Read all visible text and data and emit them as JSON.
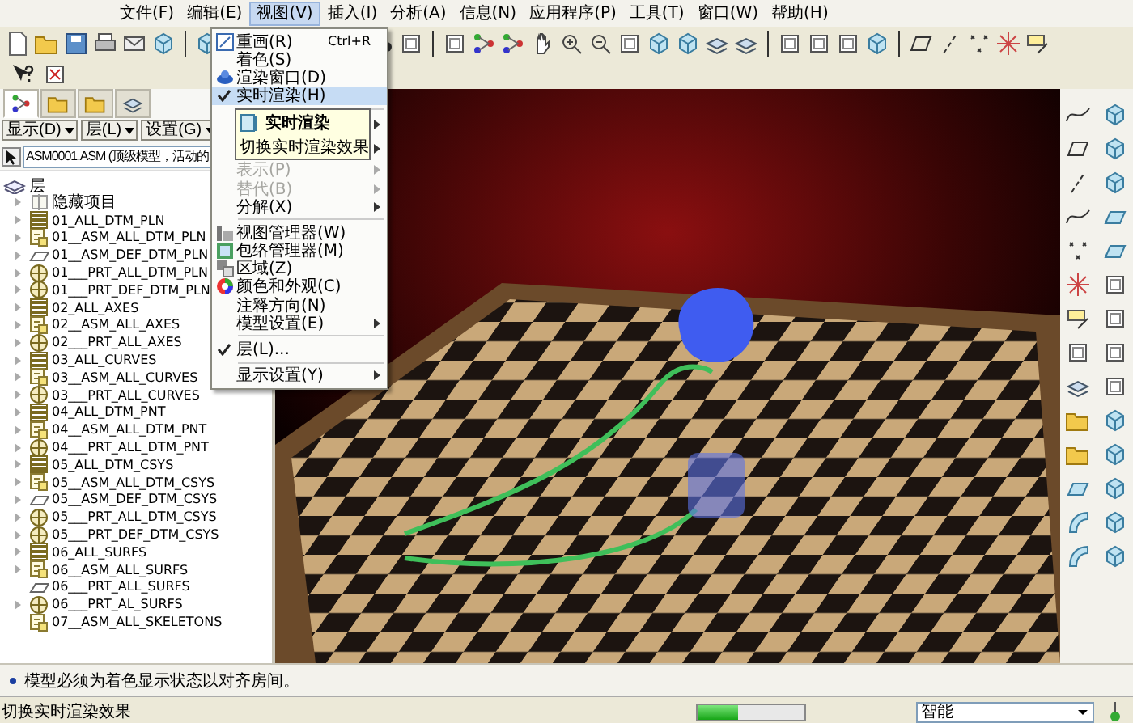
{
  "menu_bar": [
    {
      "label": "文件(F)",
      "selected": false
    },
    {
      "label": "编辑(E)",
      "selected": false
    },
    {
      "label": "视图(V)",
      "selected": true
    },
    {
      "label": "插入(I)",
      "selected": false
    },
    {
      "label": "分析(A)",
      "selected": false
    },
    {
      "label": "信息(N)",
      "selected": false
    },
    {
      "label": "应用程序(P)",
      "selected": false
    },
    {
      "label": "工具(T)",
      "selected": false
    },
    {
      "label": "窗口(W)",
      "selected": false
    },
    {
      "label": "帮助(H)",
      "selected": false
    }
  ],
  "view_menu": [
    {
      "kind": "icon",
      "label": "重画(R)",
      "shortcut": "Ctrl+R"
    },
    {
      "kind": "plain",
      "label": "着色(S)"
    },
    {
      "kind": "icon",
      "label": "渲染窗口(D)"
    },
    {
      "kind": "plain",
      "label": "实时渲染(H)",
      "checked": true,
      "selected": true
    },
    {
      "kind": "separator"
    },
    {
      "kind": "covered",
      "submenu": true
    },
    {
      "kind": "covered",
      "submenu": true
    },
    {
      "kind": "plain",
      "label": "表示(P)",
      "disabled": true,
      "submenu": true
    },
    {
      "kind": "plain",
      "label": "替代(B)",
      "disabled": true,
      "submenu": true
    },
    {
      "kind": "plain",
      "label": "分解(X)",
      "submenu": true
    },
    {
      "kind": "separator"
    },
    {
      "kind": "icon",
      "label": "视图管理器(W)"
    },
    {
      "kind": "icon",
      "label": "包络管理器(M)"
    },
    {
      "kind": "icon",
      "label": "区域(Z)"
    },
    {
      "kind": "icon",
      "label": "颜色和外观(C)"
    },
    {
      "kind": "plain",
      "label": "注释方向(N)"
    },
    {
      "kind": "plain",
      "label": "模型设置(E)",
      "submenu": true
    },
    {
      "kind": "separator"
    },
    {
      "kind": "plain",
      "label": "层(L)...",
      "checked": true
    },
    {
      "kind": "separator"
    },
    {
      "kind": "plain",
      "label": "显示设置(Y)",
      "submenu": true
    }
  ],
  "tooltip": {
    "title": "实时渲染",
    "text": "切换实时渲染效果"
  },
  "navigator_tabs": [
    {
      "selected": true
    },
    {
      "selected": false
    },
    {
      "selected": false
    },
    {
      "selected": false
    }
  ],
  "layer_buttons": [
    "显示(D)",
    "层(L)",
    "设置(G)"
  ],
  "model_selector": {
    "value": "ASM0001.ASM (顶级模型，活动的"
  },
  "layer_tree": {
    "label": "层",
    "children": [
      {
        "label": "隐藏项目",
        "kind": "hidden",
        "expandable": true
      },
      {
        "label": "01_ALL_DTM_PLN",
        "kind": "layer",
        "expandable": true
      },
      {
        "label": "01__ASM_ALL_DTM_PLN",
        "kind": "asm",
        "expandable": true
      },
      {
        "label": "01__ASM_DEF_DTM_PLN",
        "kind": "plane",
        "expandable": true
      },
      {
        "label": "01___PRT_ALL_DTM_PLN",
        "kind": "prt",
        "expandable": true
      },
      {
        "label": "01___PRT_DEF_DTM_PLN",
        "kind": "prt",
        "expandable": true
      },
      {
        "label": "02_ALL_AXES",
        "kind": "layer",
        "expandable": true
      },
      {
        "label": "02__ASM_ALL_AXES",
        "kind": "asm",
        "expandable": true
      },
      {
        "label": "02___PRT_ALL_AXES",
        "kind": "prt",
        "expandable": true
      },
      {
        "label": "03_ALL_CURVES",
        "kind": "layer",
        "expandable": true
      },
      {
        "label": "03__ASM_ALL_CURVES",
        "kind": "asm",
        "expandable": true
      },
      {
        "label": "03___PRT_ALL_CURVES",
        "kind": "prt",
        "expandable": true
      },
      {
        "label": "04_ALL_DTM_PNT",
        "kind": "layer",
        "expandable": true
      },
      {
        "label": "04__ASM_ALL_DTM_PNT",
        "kind": "asm",
        "expandable": true
      },
      {
        "label": "04___PRT_ALL_DTM_PNT",
        "kind": "prt",
        "expandable": true
      },
      {
        "label": "05_ALL_DTM_CSYS",
        "kind": "layer",
        "expandable": true
      },
      {
        "label": "05__ASM_ALL_DTM_CSYS",
        "kind": "asm",
        "expandable": true
      },
      {
        "label": "05__ASM_DEF_DTM_CSYS",
        "kind": "plane",
        "expandable": true
      },
      {
        "label": "05___PRT_ALL_DTM_CSYS",
        "kind": "prt",
        "expandable": true
      },
      {
        "label": "05___PRT_DEF_DTM_CSYS",
        "kind": "prt",
        "expandable": true
      },
      {
        "label": "06_ALL_SURFS",
        "kind": "layer",
        "expandable": true
      },
      {
        "label": "06__ASM_ALL_SURFS",
        "kind": "asm",
        "expandable": true
      },
      {
        "label": "06___PRT_ALL_SURFS",
        "kind": "plane",
        "expandable": false
      },
      {
        "label": "06___PRT_AL_SURFS",
        "kind": "prt",
        "expandable": true
      },
      {
        "label": "07__ASM_ALL_SKELETONS",
        "kind": "asm",
        "expandable": false
      }
    ]
  },
  "message": "模型必须为着色显示状态以对齐房间。",
  "status_bar": {
    "text": "切换实时渲染效果",
    "progress": {
      "level": 0.38
    },
    "filter": {
      "value": "智能"
    }
  }
}
